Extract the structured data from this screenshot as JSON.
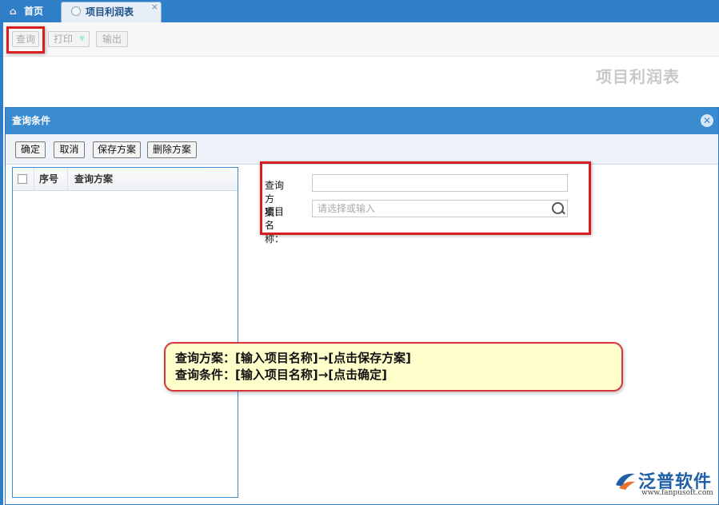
{
  "tabs": {
    "home_label": "首页",
    "active_label": "项目利润表",
    "close_glyph": "×"
  },
  "toolbar": {
    "query": "查询",
    "print": "打印",
    "export": "输出"
  },
  "report_title": "项目利润表",
  "dialog": {
    "title": "查询条件",
    "buttons": {
      "ok": "确定",
      "cancel": "取消",
      "save": "保存方案",
      "delete": "删除方案"
    },
    "grid": {
      "col_seq": "序号",
      "col_plan": "查询方案"
    },
    "form": {
      "plan_label": "查询方案：",
      "plan_value": "",
      "project_label": "项目名称：",
      "project_placeholder": "请选择或输入"
    }
  },
  "callout": {
    "line1": "查询方案：[输入项目名称]→[点击保存方案]",
    "line2": "查询条件：[输入项目名称]→[点击确定]"
  },
  "logo": {
    "name": "泛普软件",
    "url": "www.fanpusoft.com"
  },
  "colors": {
    "header_blue": "#3a8bd0",
    "highlight_red": "#d81e1e",
    "callout_fill": "#ffffcc"
  }
}
